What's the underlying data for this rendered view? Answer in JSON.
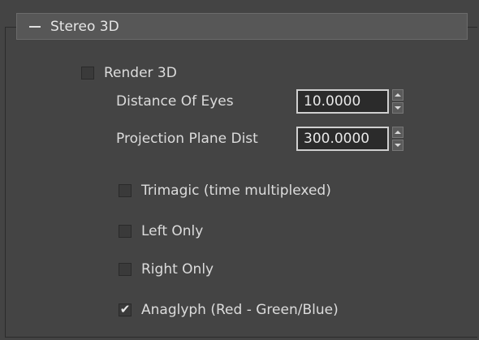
{
  "rollout": {
    "title": "Stereo 3D",
    "collapse_symbol": "minus-icon"
  },
  "render_3d": {
    "label": "Render 3D",
    "checked": false
  },
  "distance_of_eyes": {
    "label": "Distance Of Eyes",
    "value": "10.0000"
  },
  "projection_plane_dist": {
    "label": "Projection Plane Dist",
    "value": "300.0000"
  },
  "options": [
    {
      "label": "Trimagic (time multiplexed)",
      "checked": false
    },
    {
      "label": "Left Only",
      "checked": false
    },
    {
      "label": "Right Only",
      "checked": false
    },
    {
      "label": "Anaglyph (Red - Green/Blue)",
      "checked": true
    }
  ],
  "colors": {
    "background": "#444444",
    "header": "#575757",
    "field_bg": "#2b2b2b",
    "text": "#dcdcdc"
  }
}
